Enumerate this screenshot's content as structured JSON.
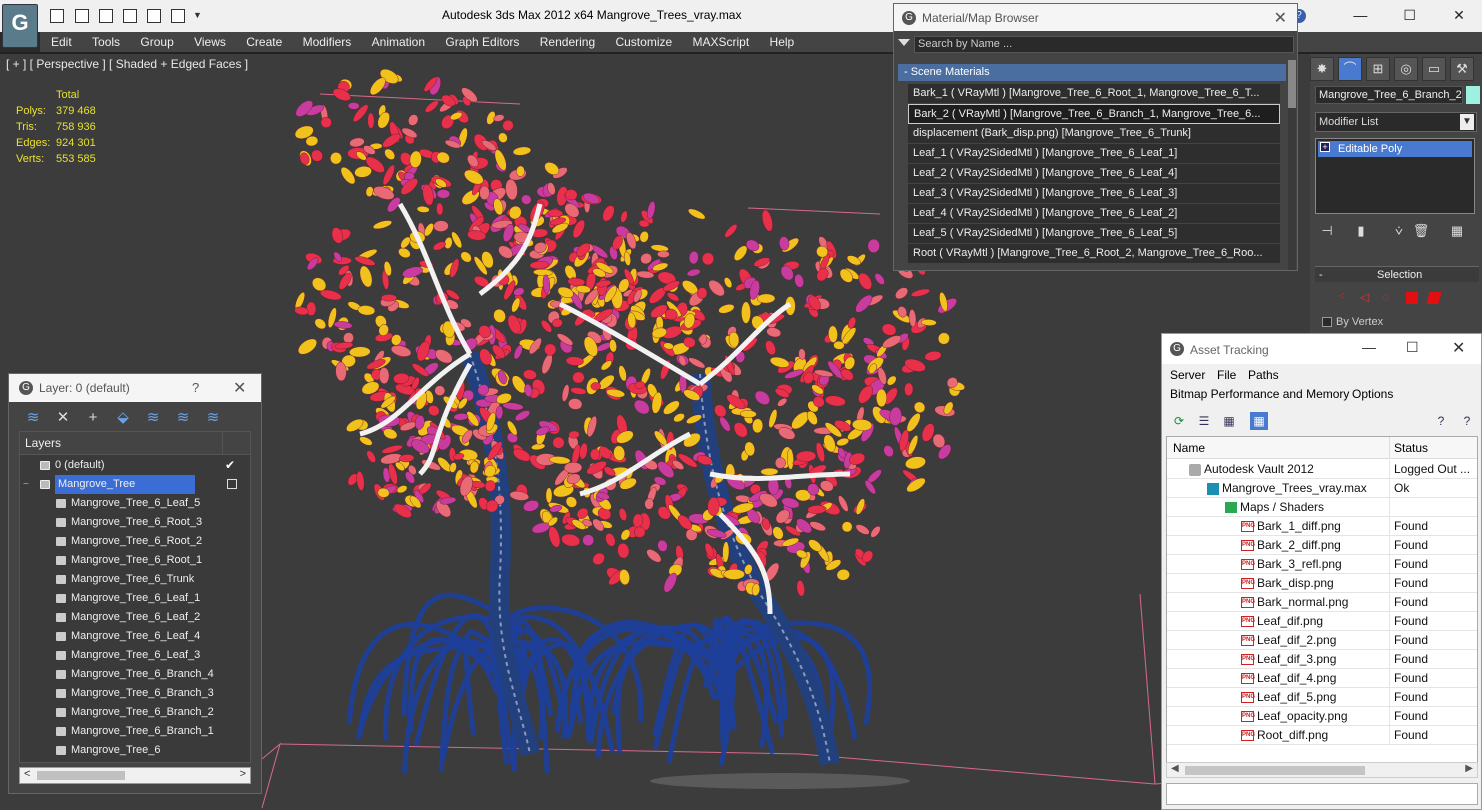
{
  "window": {
    "title": "Autodesk 3ds Max  2012 x64      Mangrove_Trees_vray.max",
    "minimize": "—",
    "maximize": "☐",
    "close": "✕"
  },
  "menu": [
    "Edit",
    "Tools",
    "Group",
    "Views",
    "Create",
    "Modifiers",
    "Animation",
    "Graph Editors",
    "Rendering",
    "Customize",
    "MAXScript",
    "Help"
  ],
  "viewport": {
    "label": "[ + ] [ Perspective ] [ Shaded + Edged Faces ]",
    "stats": {
      "header": "Total",
      "rows": [
        {
          "label": "Polys:",
          "value": "379 468"
        },
        {
          "label": "Tris:",
          "value": "758 936"
        },
        {
          "label": "Edges:",
          "value": "924 301"
        },
        {
          "label": "Verts:",
          "value": "553 585"
        }
      ]
    }
  },
  "material_browser": {
    "title": "Material/Map Browser",
    "search_placeholder": "Search by Name ...",
    "category": "- Scene Materials",
    "items": [
      "Bark_1  ( VRayMtl )  [Mangrove_Tree_6_Root_1, Mangrove_Tree_6_T...",
      "Bark_2  ( VRayMtl )  [Mangrove_Tree_6_Branch_1, Mangrove_Tree_6...",
      "displacement (Bark_disp.png) [Mangrove_Tree_6_Trunk]",
      "Leaf_1  ( VRay2SidedMtl )  [Mangrove_Tree_6_Leaf_1]",
      "Leaf_2  ( VRay2SidedMtl )  [Mangrove_Tree_6_Leaf_4]",
      "Leaf_3  ( VRay2SidedMtl )  [Mangrove_Tree_6_Leaf_3]",
      "Leaf_4  ( VRay2SidedMtl )  [Mangrove_Tree_6_Leaf_2]",
      "Leaf_5  ( VRay2SidedMtl )  [Mangrove_Tree_6_Leaf_5]",
      "Root  ( VRayMtl )  [Mangrove_Tree_6_Root_2, Mangrove_Tree_6_Roo..."
    ],
    "selected_index": 1
  },
  "command_panel": {
    "object_name": "Mangrove_Tree_6_Branch_2",
    "object_color": "#9ef0e0",
    "modifier_list": "Modifier List",
    "stack_item": "Editable Poly",
    "selection_title": "Selection",
    "by_vertex": "By Vertex"
  },
  "layer_panel": {
    "title": "Layer: 0 (default)",
    "help": "?",
    "close": "✕",
    "column": "Layers",
    "rows": [
      {
        "name": "0 (default)",
        "level": 1,
        "type": "layer"
      },
      {
        "name": "Mangrove_Tree",
        "level": 1,
        "type": "layer"
      },
      {
        "name": "Mangrove_Tree_6_Leaf_5",
        "level": 2,
        "type": "object"
      },
      {
        "name": "Mangrove_Tree_6_Root_3",
        "level": 2,
        "type": "object"
      },
      {
        "name": "Mangrove_Tree_6_Root_2",
        "level": 2,
        "type": "object"
      },
      {
        "name": "Mangrove_Tree_6_Root_1",
        "level": 2,
        "type": "object"
      },
      {
        "name": "Mangrove_Tree_6_Trunk",
        "level": 2,
        "type": "object"
      },
      {
        "name": "Mangrove_Tree_6_Leaf_1",
        "level": 2,
        "type": "object"
      },
      {
        "name": "Mangrove_Tree_6_Leaf_2",
        "level": 2,
        "type": "object"
      },
      {
        "name": "Mangrove_Tree_6_Leaf_4",
        "level": 2,
        "type": "object"
      },
      {
        "name": "Mangrove_Tree_6_Leaf_3",
        "level": 2,
        "type": "object"
      },
      {
        "name": "Mangrove_Tree_6_Branch_4",
        "level": 2,
        "type": "object"
      },
      {
        "name": "Mangrove_Tree_6_Branch_3",
        "level": 2,
        "type": "object"
      },
      {
        "name": "Mangrove_Tree_6_Branch_2",
        "level": 2,
        "type": "object"
      },
      {
        "name": "Mangrove_Tree_6_Branch_1",
        "level": 2,
        "type": "object"
      },
      {
        "name": "Mangrove_Tree_6",
        "level": 2,
        "type": "object"
      }
    ],
    "selected_index": 1,
    "checkmark": "✔"
  },
  "asset_tracking": {
    "title": "Asset Tracking",
    "menu1": [
      "Server",
      "File",
      "Paths"
    ],
    "menu2": [
      "Bitmap Performance and Memory",
      "Options"
    ],
    "col_name": "Name",
    "col_status": "Status",
    "rows": [
      {
        "name": "Autodesk Vault 2012",
        "status": "Logged Out ...",
        "indent": 22,
        "icon": "vault"
      },
      {
        "name": "Mangrove_Trees_vray.max",
        "status": "Ok",
        "indent": 40,
        "icon": "max"
      },
      {
        "name": "Maps / Shaders",
        "status": "",
        "indent": 58,
        "icon": "folder"
      },
      {
        "name": "Bark_1_diff.png",
        "status": "Found",
        "indent": 74,
        "icon": "png"
      },
      {
        "name": "Bark_2_diff.png",
        "status": "Found",
        "indent": 74,
        "icon": "png"
      },
      {
        "name": "Bark_3_refl.png",
        "status": "Found",
        "indent": 74,
        "icon": "png"
      },
      {
        "name": "Bark_disp.png",
        "status": "Found",
        "indent": 74,
        "icon": "png"
      },
      {
        "name": "Bark_normal.png",
        "status": "Found",
        "indent": 74,
        "icon": "png"
      },
      {
        "name": "Leaf_dif.png",
        "status": "Found",
        "indent": 74,
        "icon": "png"
      },
      {
        "name": "Leaf_dif_2.png",
        "status": "Found",
        "indent": 74,
        "icon": "png"
      },
      {
        "name": "Leaf_dif_3.png",
        "status": "Found",
        "indent": 74,
        "icon": "png"
      },
      {
        "name": "Leaf_dif_4.png",
        "status": "Found",
        "indent": 74,
        "icon": "png"
      },
      {
        "name": "Leaf_dif_5.png",
        "status": "Found",
        "indent": 74,
        "icon": "png"
      },
      {
        "name": "Leaf_opacity.png",
        "status": "Found",
        "indent": 74,
        "icon": "png"
      },
      {
        "name": "Root_diff.png",
        "status": "Found",
        "indent": 74,
        "icon": "png"
      }
    ]
  },
  "colors": {
    "leaf_yellow": "#f2c21c",
    "leaf_red": "#e8304a",
    "leaf_pink": "#e86a74",
    "root_blue": "#1d3f9a",
    "branch_white": "#f2f2f2",
    "selection_blue": "#3a6ed6"
  }
}
